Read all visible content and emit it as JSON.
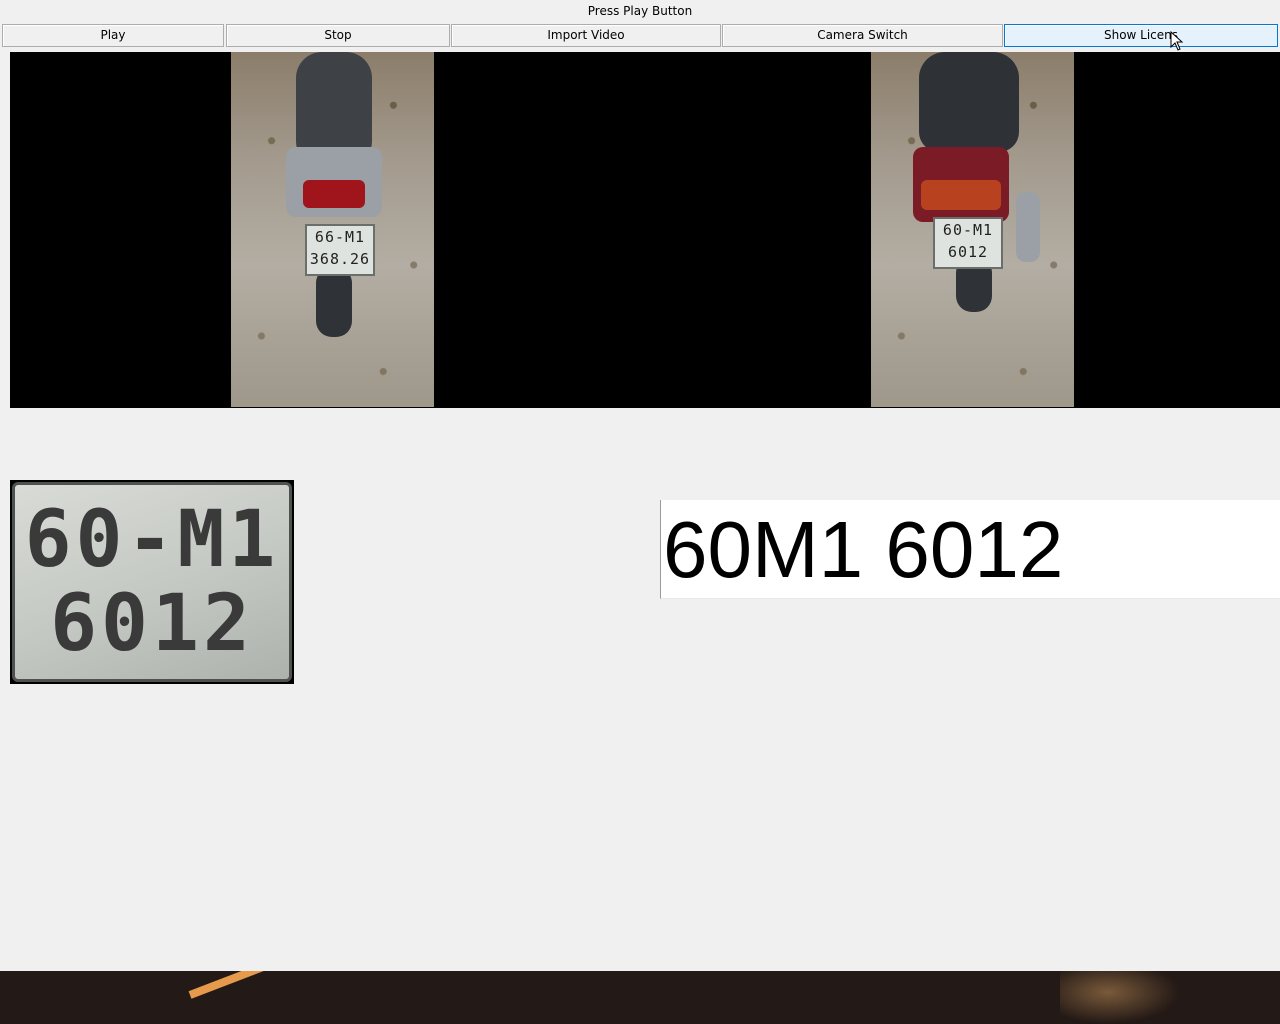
{
  "window": {
    "title": "Press Play Button"
  },
  "toolbar": {
    "play_label": "Play",
    "stop_label": "Stop",
    "import_label": "Import Video",
    "camera_label": "Camera Switch",
    "show_license_label": "Show Licens"
  },
  "video": {
    "left_plate": {
      "line1": "66-M1",
      "line2": "368.26"
    },
    "right_plate": {
      "line1": "60-M1",
      "line2": "6012"
    }
  },
  "plate_crop": {
    "line1": "60-M1",
    "line2": "6012"
  },
  "plate_result": {
    "text": "60M1 6012"
  },
  "colors": {
    "background": "#f0f0f0",
    "video_bg": "#000000",
    "hover_button": "#e5f1fb",
    "hover_border": "#0078d7"
  },
  "icons": {
    "cursor": "mouse-pointer-icon"
  }
}
